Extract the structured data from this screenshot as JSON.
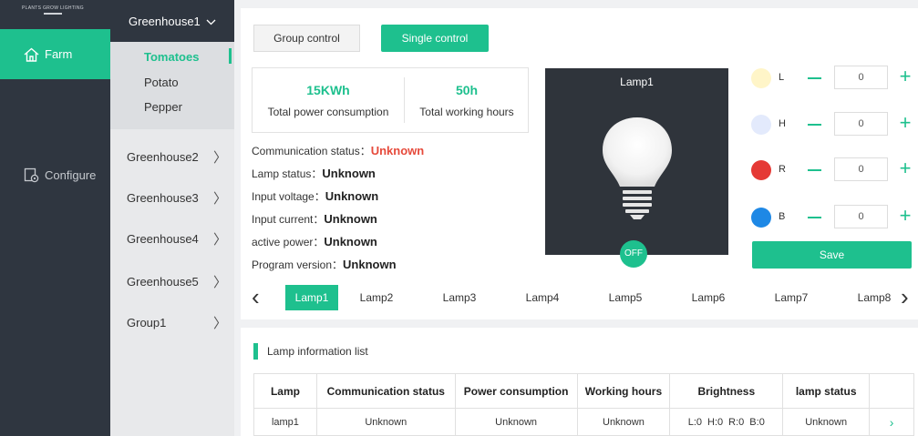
{
  "nav": {
    "logo_text": "PLANTS GROW LIGHTING",
    "farm_label": "Farm",
    "configure_label": "Configure"
  },
  "greenhouses": {
    "active": "Greenhouse1",
    "sub_items": [
      "Tomatoes",
      "Potato",
      "Pepper"
    ],
    "items": [
      "Greenhouse2",
      "Greenhouse3",
      "Greenhouse4",
      "Greenhouse5",
      "Group1"
    ]
  },
  "controls": {
    "group_label": "Group control",
    "single_label": "Single control"
  },
  "stats": {
    "power_value": "15KWh",
    "power_label": "Total power consumption",
    "hours_value": "50h",
    "hours_label": "Total working hours"
  },
  "info": {
    "comm_label": "Communication status：",
    "comm_value": "Unknown",
    "lamp_label": "Lamp status：",
    "lamp_value": "Unknown",
    "voltage_label": "Input voltage：",
    "voltage_value": "Unknown",
    "current_label": "Input current：",
    "current_value": "Unknown",
    "power_label": "active power：",
    "power_value": "Unknown",
    "program_label": "Program version：",
    "program_value": "Unknown"
  },
  "lamp_view": {
    "title": "Lamp1",
    "state": "OFF"
  },
  "channels": [
    {
      "label": "L",
      "value": "0",
      "color": "#fff5c8"
    },
    {
      "label": "H",
      "value": "0",
      "color": "#e3eafc"
    },
    {
      "label": "R",
      "value": "0",
      "color": "#e53935"
    },
    {
      "label": "B",
      "value": "0",
      "color": "#1e88e5"
    }
  ],
  "save_label": "Save",
  "lamp_tabs": [
    "Lamp1",
    "Lamp2",
    "Lamp3",
    "Lamp4",
    "Lamp5",
    "Lamp6",
    "Lamp7",
    "Lamp8"
  ],
  "active_lamp_tab": 0,
  "list": {
    "title": "Lamp information list",
    "headers": [
      "Lamp",
      "Communication status",
      "Power consumption",
      "Working hours",
      "Brightness",
      "lamp status"
    ],
    "rows": [
      {
        "lamp": "lamp1",
        "comm": "Unknown",
        "power": "Unknown",
        "hours": "Unknown",
        "brightness": [
          "L:0",
          "H:0",
          "R:0",
          "B:0"
        ],
        "status": "Unknown"
      }
    ]
  },
  "theme": {
    "accent": "#1ec08e",
    "nav_bg": "#2f3640",
    "warn": "#e64a3b"
  }
}
